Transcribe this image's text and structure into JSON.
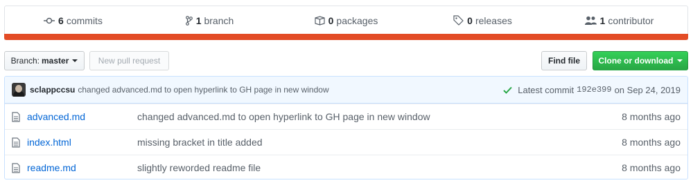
{
  "stats": {
    "commits": {
      "count": "6",
      "label": "commits",
      "icon": "commit-icon"
    },
    "branches": {
      "count": "1",
      "label": "branch",
      "icon": "branch-icon"
    },
    "packages": {
      "count": "0",
      "label": "packages",
      "icon": "package-icon"
    },
    "releases": {
      "count": "0",
      "label": "releases",
      "icon": "tag-icon"
    },
    "contributors": {
      "count": "1",
      "label": "contributor",
      "icon": "people-icon"
    }
  },
  "language_bar_color": "#e34c26",
  "toolbar": {
    "branch_prefix": "Branch:",
    "branch_name": "master",
    "new_pr_label": "New pull request",
    "find_file_label": "Find file",
    "clone_label": "Clone or download"
  },
  "latest_commit": {
    "author": "sclappccsu",
    "message": "changed advanced.md to open hyperlink to GH page in new window",
    "prefix": "Latest commit",
    "sha": "192e399",
    "date": "on Sep 24, 2019"
  },
  "files": [
    {
      "name": "advanced.md",
      "message": "changed advanced.md to open hyperlink to GH page in new window",
      "age": "8 months ago"
    },
    {
      "name": "index.html",
      "message": "missing bracket in title added",
      "age": "8 months ago"
    },
    {
      "name": "readme.md",
      "message": "slightly reworded readme file",
      "age": "8 months ago"
    }
  ]
}
